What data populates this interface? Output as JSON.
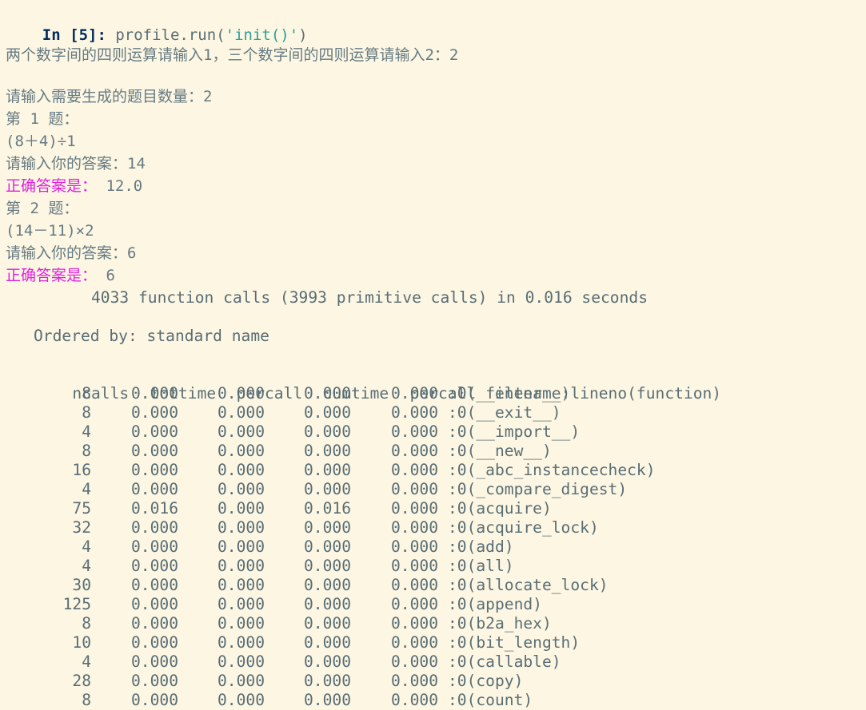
{
  "cell": {
    "prompt_label": "In",
    "prompt_open": "[",
    "prompt_number": "5",
    "prompt_close": "]:",
    "code_call": "profile.run(",
    "code_string": "'init()'",
    "code_close": ")"
  },
  "output": {
    "line1": "两个数字间的四则运算请输入1，三个数字间的四则运算请输入2：2",
    "line2": "请输入需要生成的题目数量：2",
    "line3": "第 1 题：",
    "line4": "(8＋4)÷1",
    "line5": "请输入你的答案：14",
    "line6_label": "正确答案是：",
    "line6_value": " 12.0",
    "line7": "第 2 题：",
    "line8": "(14－11)×2",
    "line9": "请输入你的答案：6",
    "line10_label": "正确答案是：",
    "line10_value": " 6"
  },
  "profile": {
    "summary": "4033 function calls (3993 primitive calls) in 0.016 seconds",
    "ordered_by": "Ordered by: standard name",
    "headers": [
      "ncalls",
      "tottime",
      "percall",
      "cumtime",
      "percall",
      "filename:lineno(function)"
    ],
    "rows": [
      [
        "8",
        "0.000",
        "0.000",
        "0.000",
        "0.000",
        ":0(__enter__)"
      ],
      [
        "8",
        "0.000",
        "0.000",
        "0.000",
        "0.000",
        ":0(__exit__)"
      ],
      [
        "4",
        "0.000",
        "0.000",
        "0.000",
        "0.000",
        ":0(__import__)"
      ],
      [
        "8",
        "0.000",
        "0.000",
        "0.000",
        "0.000",
        ":0(__new__)"
      ],
      [
        "16",
        "0.000",
        "0.000",
        "0.000",
        "0.000",
        ":0(_abc_instancecheck)"
      ],
      [
        "4",
        "0.000",
        "0.000",
        "0.000",
        "0.000",
        ":0(_compare_digest)"
      ],
      [
        "75",
        "0.016",
        "0.000",
        "0.016",
        "0.000",
        ":0(acquire)"
      ],
      [
        "32",
        "0.000",
        "0.000",
        "0.000",
        "0.000",
        ":0(acquire_lock)"
      ],
      [
        "4",
        "0.000",
        "0.000",
        "0.000",
        "0.000",
        ":0(add)"
      ],
      [
        "4",
        "0.000",
        "0.000",
        "0.000",
        "0.000",
        ":0(all)"
      ],
      [
        "30",
        "0.000",
        "0.000",
        "0.000",
        "0.000",
        ":0(allocate_lock)"
      ],
      [
        "125",
        "0.000",
        "0.000",
        "0.000",
        "0.000",
        ":0(append)"
      ],
      [
        "8",
        "0.000",
        "0.000",
        "0.000",
        "0.000",
        ":0(b2a_hex)"
      ],
      [
        "10",
        "0.000",
        "0.000",
        "0.000",
        "0.000",
        ":0(bit_length)"
      ],
      [
        "4",
        "0.000",
        "0.000",
        "0.000",
        "0.000",
        ":0(callable)"
      ],
      [
        "28",
        "0.000",
        "0.000",
        "0.000",
        "0.000",
        ":0(copy)"
      ],
      [
        "8",
        "0.000",
        "0.000",
        "0.000",
        "0.000",
        ":0(count)"
      ]
    ]
  },
  "colors": {
    "background": "#fdf6e3",
    "text": "#657b83",
    "prompt": "#002b5e",
    "string": "#2aa198",
    "highlight": "#e020e0"
  }
}
